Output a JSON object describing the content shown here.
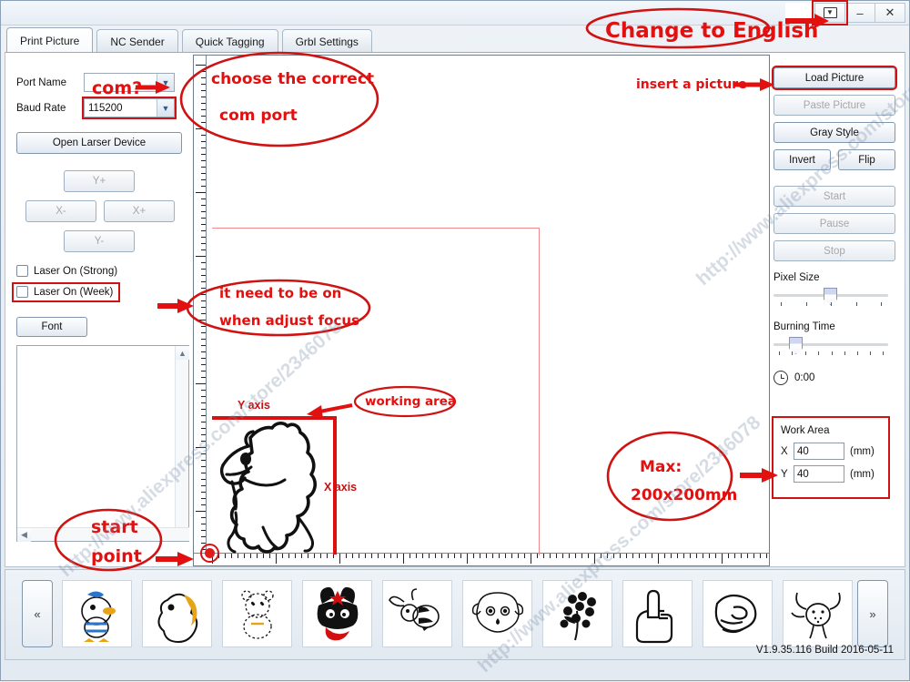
{
  "window": {
    "lang_button_icon": "language-dropdown-icon",
    "minimize_label": "–",
    "close_label": "✕"
  },
  "tabs": [
    {
      "label": "Print Picture",
      "active": true
    },
    {
      "label": "NC Sender",
      "active": false
    },
    {
      "label": "Quick Tagging",
      "active": false
    },
    {
      "label": "Grbl Settings",
      "active": false
    }
  ],
  "left_panel": {
    "port_name_label": "Port Name",
    "port_name_value": "",
    "baud_rate_label": "Baud Rate",
    "baud_rate_value": "115200",
    "open_device_label": "Open Larser Device",
    "jog": {
      "y_plus": "Y+",
      "x_minus": "X-",
      "x_plus": "X+",
      "y_minus": "Y-"
    },
    "laser_strong_label": "Laser On (Strong)",
    "laser_week_label": "Laser On (Week)",
    "laser_strong_checked": false,
    "laser_week_checked": false,
    "font_button_label": "Font",
    "text_area_value": ""
  },
  "right_panel": {
    "load_picture": "Load Picture",
    "paste_picture": "Paste Picture",
    "gray_style": "Gray Style",
    "invert": "Invert",
    "flip": "Flip",
    "start": "Start",
    "pause": "Pause",
    "stop": "Stop",
    "pixel_size_label": "Pixel Size",
    "burning_time_label": "Burning Time",
    "time_value": "0:00",
    "work_area_title": "Work Area",
    "work_area_x_label": "X",
    "work_area_x_value": "40",
    "work_area_y_label": "Y",
    "work_area_y_value": "40",
    "unit_x": "(mm)",
    "unit_y": "(mm)"
  },
  "canvas": {
    "y_axis_label": "Y axis",
    "x_axis_label": "X axis"
  },
  "bottom_strip": {
    "prev_label": "«",
    "next_label": "»",
    "version": "V1.9.35.116 Build 2016-05-11",
    "thumbnails": [
      {
        "name": "duck"
      },
      {
        "name": "horse"
      },
      {
        "name": "bear"
      },
      {
        "name": "rabbit-hat"
      },
      {
        "name": "bee"
      },
      {
        "name": "sheep"
      },
      {
        "name": "flower"
      },
      {
        "name": "hand-finger"
      },
      {
        "name": "pointing-hand"
      },
      {
        "name": "bull"
      }
    ]
  },
  "annotations": {
    "change_to_english": "Change to English",
    "choose_com_port_line1": "choose the correct",
    "choose_com_port_line2": "com port",
    "com_question": "com?",
    "insert_a_picture": "insert a picture",
    "need_on_line1": "it need to be on",
    "need_on_line2": "when adjust focus",
    "working_area": "working area",
    "max_line1": "Max:",
    "max_line2": "200x200mm",
    "start_line1": "start",
    "start_line2": "point"
  },
  "watermark": {
    "text": "http://www.aliexpress.com/store/2346078"
  },
  "colors": {
    "annotation_red": "#e31010",
    "highlight_red": "#cf1212",
    "axis_red": "#d91111"
  }
}
